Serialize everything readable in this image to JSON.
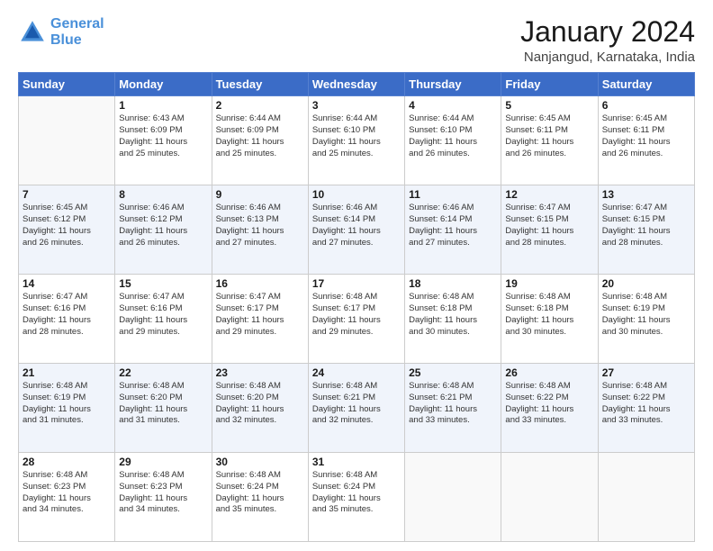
{
  "header": {
    "logo_line1": "General",
    "logo_line2": "Blue",
    "title": "January 2024",
    "subtitle": "Nanjangud, Karnataka, India"
  },
  "weekdays": [
    "Sunday",
    "Monday",
    "Tuesday",
    "Wednesday",
    "Thursday",
    "Friday",
    "Saturday"
  ],
  "weeks": [
    [
      {
        "day": "",
        "info": ""
      },
      {
        "day": "1",
        "info": "Sunrise: 6:43 AM\nSunset: 6:09 PM\nDaylight: 11 hours\nand 25 minutes."
      },
      {
        "day": "2",
        "info": "Sunrise: 6:44 AM\nSunset: 6:09 PM\nDaylight: 11 hours\nand 25 minutes."
      },
      {
        "day": "3",
        "info": "Sunrise: 6:44 AM\nSunset: 6:10 PM\nDaylight: 11 hours\nand 25 minutes."
      },
      {
        "day": "4",
        "info": "Sunrise: 6:44 AM\nSunset: 6:10 PM\nDaylight: 11 hours\nand 26 minutes."
      },
      {
        "day": "5",
        "info": "Sunrise: 6:45 AM\nSunset: 6:11 PM\nDaylight: 11 hours\nand 26 minutes."
      },
      {
        "day": "6",
        "info": "Sunrise: 6:45 AM\nSunset: 6:11 PM\nDaylight: 11 hours\nand 26 minutes."
      }
    ],
    [
      {
        "day": "7",
        "info": "Sunrise: 6:45 AM\nSunset: 6:12 PM\nDaylight: 11 hours\nand 26 minutes."
      },
      {
        "day": "8",
        "info": "Sunrise: 6:46 AM\nSunset: 6:12 PM\nDaylight: 11 hours\nand 26 minutes."
      },
      {
        "day": "9",
        "info": "Sunrise: 6:46 AM\nSunset: 6:13 PM\nDaylight: 11 hours\nand 27 minutes."
      },
      {
        "day": "10",
        "info": "Sunrise: 6:46 AM\nSunset: 6:14 PM\nDaylight: 11 hours\nand 27 minutes."
      },
      {
        "day": "11",
        "info": "Sunrise: 6:46 AM\nSunset: 6:14 PM\nDaylight: 11 hours\nand 27 minutes."
      },
      {
        "day": "12",
        "info": "Sunrise: 6:47 AM\nSunset: 6:15 PM\nDaylight: 11 hours\nand 28 minutes."
      },
      {
        "day": "13",
        "info": "Sunrise: 6:47 AM\nSunset: 6:15 PM\nDaylight: 11 hours\nand 28 minutes."
      }
    ],
    [
      {
        "day": "14",
        "info": "Sunrise: 6:47 AM\nSunset: 6:16 PM\nDaylight: 11 hours\nand 28 minutes."
      },
      {
        "day": "15",
        "info": "Sunrise: 6:47 AM\nSunset: 6:16 PM\nDaylight: 11 hours\nand 29 minutes."
      },
      {
        "day": "16",
        "info": "Sunrise: 6:47 AM\nSunset: 6:17 PM\nDaylight: 11 hours\nand 29 minutes."
      },
      {
        "day": "17",
        "info": "Sunrise: 6:48 AM\nSunset: 6:17 PM\nDaylight: 11 hours\nand 29 minutes."
      },
      {
        "day": "18",
        "info": "Sunrise: 6:48 AM\nSunset: 6:18 PM\nDaylight: 11 hours\nand 30 minutes."
      },
      {
        "day": "19",
        "info": "Sunrise: 6:48 AM\nSunset: 6:18 PM\nDaylight: 11 hours\nand 30 minutes."
      },
      {
        "day": "20",
        "info": "Sunrise: 6:48 AM\nSunset: 6:19 PM\nDaylight: 11 hours\nand 30 minutes."
      }
    ],
    [
      {
        "day": "21",
        "info": "Sunrise: 6:48 AM\nSunset: 6:19 PM\nDaylight: 11 hours\nand 31 minutes."
      },
      {
        "day": "22",
        "info": "Sunrise: 6:48 AM\nSunset: 6:20 PM\nDaylight: 11 hours\nand 31 minutes."
      },
      {
        "day": "23",
        "info": "Sunrise: 6:48 AM\nSunset: 6:20 PM\nDaylight: 11 hours\nand 32 minutes."
      },
      {
        "day": "24",
        "info": "Sunrise: 6:48 AM\nSunset: 6:21 PM\nDaylight: 11 hours\nand 32 minutes."
      },
      {
        "day": "25",
        "info": "Sunrise: 6:48 AM\nSunset: 6:21 PM\nDaylight: 11 hours\nand 33 minutes."
      },
      {
        "day": "26",
        "info": "Sunrise: 6:48 AM\nSunset: 6:22 PM\nDaylight: 11 hours\nand 33 minutes."
      },
      {
        "day": "27",
        "info": "Sunrise: 6:48 AM\nSunset: 6:22 PM\nDaylight: 11 hours\nand 33 minutes."
      }
    ],
    [
      {
        "day": "28",
        "info": "Sunrise: 6:48 AM\nSunset: 6:23 PM\nDaylight: 11 hours\nand 34 minutes."
      },
      {
        "day": "29",
        "info": "Sunrise: 6:48 AM\nSunset: 6:23 PM\nDaylight: 11 hours\nand 34 minutes."
      },
      {
        "day": "30",
        "info": "Sunrise: 6:48 AM\nSunset: 6:24 PM\nDaylight: 11 hours\nand 35 minutes."
      },
      {
        "day": "31",
        "info": "Sunrise: 6:48 AM\nSunset: 6:24 PM\nDaylight: 11 hours\nand 35 minutes."
      },
      {
        "day": "",
        "info": ""
      },
      {
        "day": "",
        "info": ""
      },
      {
        "day": "",
        "info": ""
      }
    ]
  ]
}
